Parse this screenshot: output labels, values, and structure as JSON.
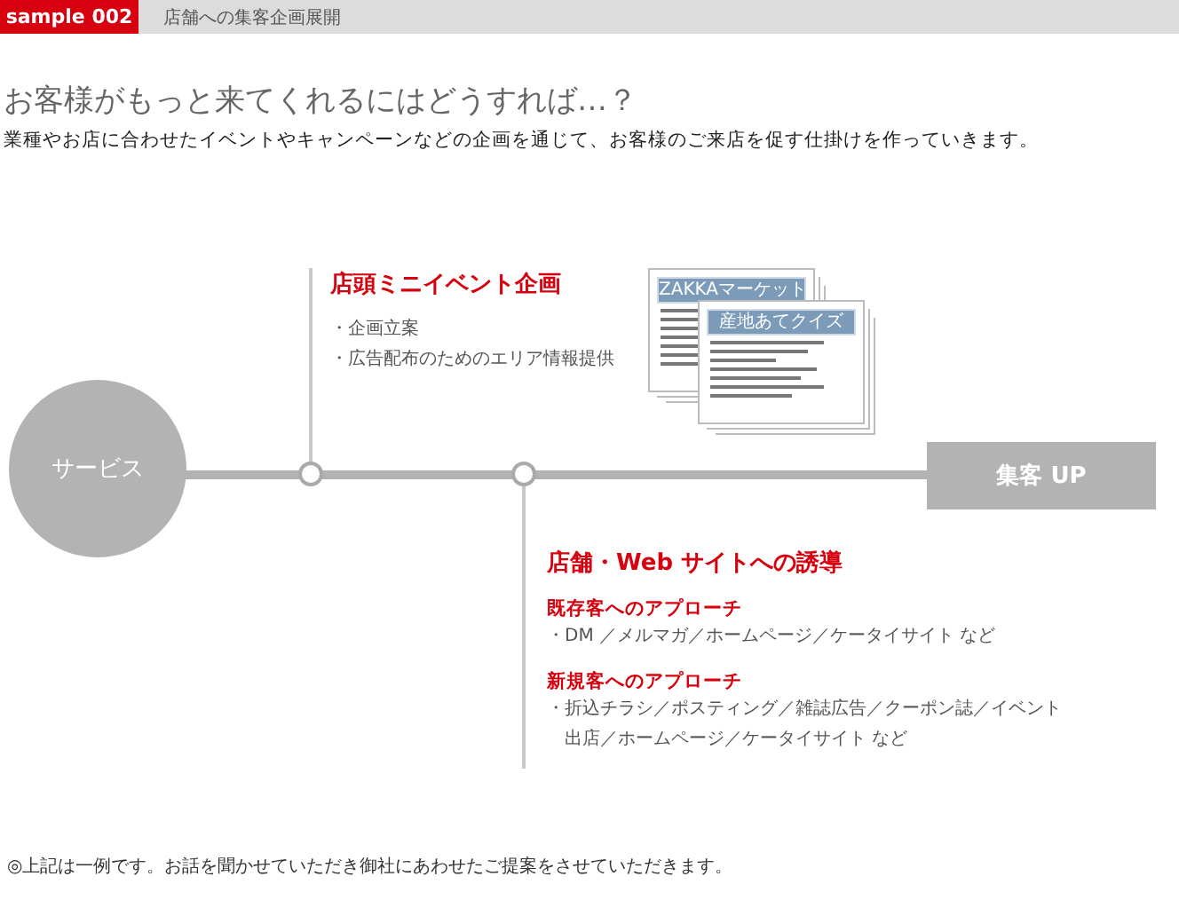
{
  "header": {
    "badge": "sample 002",
    "title": "店舗への集客企画展開"
  },
  "headline": "お客様がもっと来てくれるにはどうすれば…？",
  "lead": "業種やお店に合わせたイベントやキャンペーンなどの企画を通じて、お客様のご来店を促す仕掛けを作っていきます。",
  "diagram": {
    "start": "サービス",
    "goal": "集客 UP",
    "branches": [
      {
        "title": "店頭ミニイベント企画",
        "groups": [
          {
            "items": [
              "・企画立案",
              "・広告配布のためのエリア情報提供"
            ]
          }
        ],
        "documents": [
          "ZAKKAマーケット",
          "産地あてクイズ"
        ]
      },
      {
        "title": "店舗・Web サイトへの誘導",
        "groups": [
          {
            "heading": "既存客へのアプローチ",
            "items": [
              "・DM ／メルマガ／ホームページ／ケータイサイト など"
            ]
          },
          {
            "heading": "新規客へのアプローチ",
            "items": [
              "・折込チラシ／ポスティング／雑誌広告／クーポン誌／イベント出店／ホームページ／ケータイサイト など"
            ]
          }
        ]
      }
    ]
  },
  "note": "◎上記は一例です。お話を聞かせていただき御社にあわせたご提案をさせていただきます。"
}
